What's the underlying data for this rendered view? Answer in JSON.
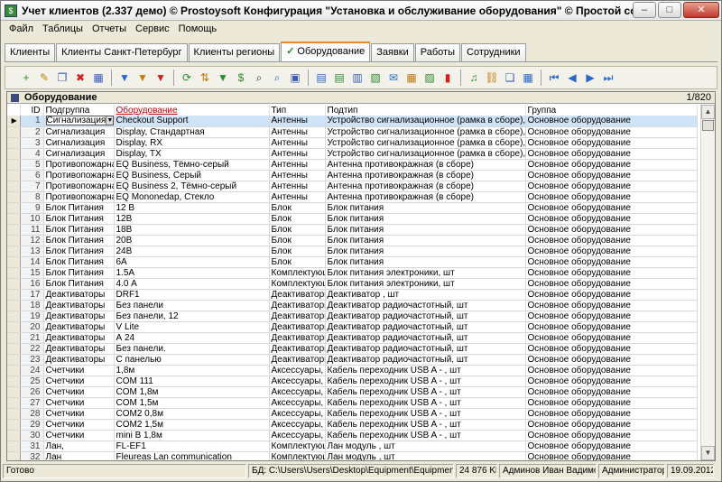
{
  "window": {
    "title": "Учет клиентов (2.337 демо) © Prostoysoft  Конфигурация \"Установка и обслуживание оборудования\" © Простой софт",
    "min": "–",
    "max": "□",
    "close": "✕"
  },
  "menu": [
    {
      "label": "Файл"
    },
    {
      "label": "Таблицы"
    },
    {
      "label": "Отчеты"
    },
    {
      "label": "Сервис"
    },
    {
      "label": "Помощь"
    }
  ],
  "tabs": [
    {
      "label": "Клиенты"
    },
    {
      "label": "Клиенты Санкт-Петербург"
    },
    {
      "label": "Клиенты регионы"
    },
    {
      "label": "Оборудование",
      "active": true
    },
    {
      "label": "Заявки"
    },
    {
      "label": "Работы"
    },
    {
      "label": "Сотрудники"
    }
  ],
  "toolbar": [
    {
      "icon": "add-record-icon",
      "glyph": "+",
      "color": "#2e8b2e"
    },
    {
      "icon": "edit-icon",
      "glyph": "✎",
      "color": "#b8860b"
    },
    {
      "icon": "copy-icon",
      "glyph": "❐",
      "color": "#3b5bb5"
    },
    {
      "icon": "delete-icon",
      "glyph": "✖",
      "color": "#d02020"
    },
    {
      "icon": "card-icon",
      "glyph": "▦",
      "color": "#3b5bb5"
    },
    {
      "sep": true
    },
    {
      "icon": "filter-icon",
      "glyph": "▼",
      "color": "#2a66c8"
    },
    {
      "icon": "filter-edit-icon",
      "glyph": "▼",
      "color": "#c07a10"
    },
    {
      "icon": "filter-clear-icon",
      "glyph": "▼",
      "color": "#d02020"
    },
    {
      "sep": true
    },
    {
      "icon": "refresh-icon",
      "glyph": "⟳",
      "color": "#2e8b2e"
    },
    {
      "icon": "sort-asc-icon",
      "glyph": "⇅",
      "color": "#c07a10"
    },
    {
      "icon": "sort-filter-icon",
      "glyph": "▼",
      "color": "#2e8b2e"
    },
    {
      "icon": "dollar-icon",
      "glyph": "$",
      "color": "#2e8b2e"
    },
    {
      "icon": "find-icon",
      "glyph": "⌕",
      "color": "#333333"
    },
    {
      "icon": "find-next-icon",
      "glyph": "⌕",
      "color": "#2a66c8"
    },
    {
      "icon": "preview-icon",
      "glyph": "▣",
      "color": "#3b5bb5"
    },
    {
      "sep": true
    },
    {
      "icon": "export-icon",
      "glyph": "▤",
      "color": "#2a66c8"
    },
    {
      "icon": "import-icon",
      "glyph": "▤",
      "color": "#2e8b2e"
    },
    {
      "icon": "print-icon",
      "glyph": "▥",
      "color": "#3b5bb5"
    },
    {
      "icon": "report-icon",
      "glyph": "▧",
      "color": "#2e8b2e"
    },
    {
      "icon": "mail-icon",
      "glyph": "✉",
      "color": "#2a66c8"
    },
    {
      "icon": "calendar-icon",
      "glyph": "▦",
      "color": "#c07a10"
    },
    {
      "icon": "photo-icon",
      "glyph": "▨",
      "color": "#2e8b2e"
    },
    {
      "icon": "chart-icon",
      "glyph": "▮",
      "color": "#d02020"
    },
    {
      "sep": true
    },
    {
      "icon": "music-icon",
      "glyph": "♫",
      "color": "#2e8b2e"
    },
    {
      "icon": "link-icon",
      "glyph": "⛓",
      "color": "#c07a10"
    },
    {
      "icon": "attach-icon",
      "glyph": "❏",
      "color": "#3b5bb5"
    },
    {
      "icon": "table-settings-icon",
      "glyph": "▦",
      "color": "#2a66c8"
    },
    {
      "sep": true
    },
    {
      "icon": "first-record-icon",
      "glyph": "⏮",
      "color": "#2a66c8"
    },
    {
      "icon": "prev-record-icon",
      "glyph": "◀",
      "color": "#2a66c8"
    },
    {
      "icon": "next-record-icon",
      "glyph": "▶",
      "color": "#2a66c8"
    },
    {
      "icon": "last-record-icon",
      "glyph": "⏭",
      "color": "#2a66c8"
    }
  ],
  "panel": {
    "title": "Оборудование",
    "counter": "1/820"
  },
  "columns": [
    "ID",
    "Подгруппа",
    "Оборудование",
    "Тип",
    "Подтип",
    "Группа"
  ],
  "rows": [
    [
      "1",
      "Сигнализация",
      "Checkout Support",
      "Антенны",
      "Устройство сигнализационное (рамка в сборе), шт",
      "Основное оборудование"
    ],
    [
      "2",
      "Сигнализация",
      "Display, Стандартная",
      "Антенны",
      "Устройство сигнализационное (рамка в сборе), шт",
      "Основное оборудование"
    ],
    [
      "3",
      "Сигнализация",
      "Display, RX",
      "Антенны",
      "Устройство сигнализационное (рамка в сборе), шт",
      "Основное оборудование"
    ],
    [
      "4",
      "Сигнализация",
      "Display, TX",
      "Антенны",
      "Устройство сигнализационное (рамка в сборе), шт",
      "Основное оборудование"
    ],
    [
      "5",
      "Противопожарная",
      "EQ Business, Тёмно-серый",
      "Антенны",
      "Антенна противокражная (в сборе)",
      "Основное оборудование"
    ],
    [
      "6",
      "Противопожарная",
      "EQ Business, Серый",
      "Антенны",
      "Антенна противокражная (в сборе)",
      "Основное оборудование"
    ],
    [
      "7",
      "Противопожарная",
      "EQ Business 2, Тёмно-серый",
      "Антенны",
      "Антенна противокражная (в сборе)",
      "Основное оборудование"
    ],
    [
      "8",
      "Противопожарная",
      "EQ Mononedap, Стекло",
      "Антенны",
      "Антенна противокражная (в сборе)",
      "Основное оборудование"
    ],
    [
      "9",
      "Блок Питания",
      "12 В",
      "Блок",
      "Блок питания",
      "Основное оборудование"
    ],
    [
      "10",
      "Блок Питания",
      "12В",
      "Блок",
      "Блок питания",
      "Основное оборудование"
    ],
    [
      "11",
      "Блок Питания",
      "18В",
      "Блок",
      "Блок питания",
      "Основное оборудование"
    ],
    [
      "12",
      "Блок Питания",
      "20В",
      "Блок",
      "Блок питания",
      "Основное оборудование"
    ],
    [
      "13",
      "Блок Питания",
      "24В",
      "Блок",
      "Блок питания",
      "Основное оборудование"
    ],
    [
      "14",
      "Блок Питания",
      "6А",
      "Блок",
      "Блок питания",
      "Основное оборудование"
    ],
    [
      "15",
      "Блок Питания",
      "1.5А",
      "Комплектующ",
      "Блок питания электроники, шт",
      "Основное оборудование"
    ],
    [
      "16",
      "Блок Питания",
      "4.0 А",
      "Комплектующ",
      "Блок питания электроники, шт",
      "Основное оборудование"
    ],
    [
      "17",
      "Деактиваторы",
      "DRF1",
      "Деактиваторы",
      "Деактиватор , шт",
      "Основное оборудование"
    ],
    [
      "18",
      "Деактиваторы",
      "Без панели",
      "Деактиваторы",
      "Деактиватор радиочастотный, шт",
      "Основное оборудование"
    ],
    [
      "19",
      "Деактиваторы",
      "Без панели, 12",
      "Деактиваторы",
      "Деактиватор радиочастотный, шт",
      "Основное оборудование"
    ],
    [
      "20",
      "Деактиваторы",
      "V Lite",
      "Деактиваторы",
      "Деактиватор радиочастотный, шт",
      "Основное оборудование"
    ],
    [
      "21",
      "Деактиваторы",
      "А 24",
      "Деактиваторы",
      "Деактиватор радиочастотный, шт",
      "Основное оборудование"
    ],
    [
      "22",
      "Деактиваторы",
      "Без панели.",
      "Деактиваторы",
      "Деактиватор радиочастотный, шт",
      "Основное оборудование"
    ],
    [
      "23",
      "Деактиваторы",
      "С панелью",
      "Деактиваторы",
      "Деактиватор радиочастотный, шт",
      "Основное оборудование"
    ],
    [
      "24",
      "Счетчики",
      "1,8м",
      "Аксессуары,",
      "Кабель переходник USB A -  , шт",
      "Основное оборудование"
    ],
    [
      "25",
      "Счетчики",
      "COM 111",
      "Аксессуары,",
      "Кабель переходник USB A -  , шт",
      "Основное оборудование"
    ],
    [
      "26",
      "Счетчики",
      "COM 1,8м",
      "Аксессуары,",
      "Кабель переходник USB A -  , шт",
      "Основное оборудование"
    ],
    [
      "27",
      "Счетчики",
      "COM 1,5м",
      "Аксессуары,",
      "Кабель переходник USB A -  , шт",
      "Основное оборудование"
    ],
    [
      "28",
      "Счетчики",
      "COM2 0,8м",
      "Аксессуары,",
      "Кабель переходник USB A -  , шт",
      "Основное оборудование"
    ],
    [
      "29",
      "Счетчики",
      "COM2 1,5м",
      "Аксессуары,",
      "Кабель переходник USB A -  , шт",
      "Основное оборудование"
    ],
    [
      "30",
      "Счетчики",
      "mini B 1,8м",
      "Аксессуары,",
      "Кабель переходник USB A -  , шт",
      "Основное оборудование"
    ],
    [
      "31",
      "Лан,",
      "FL-EF1",
      "Комплектующ",
      "Лан модуль , шт",
      "Основное оборудование"
    ],
    [
      "32",
      "Лан",
      "Fleureas Lan communication",
      "Комплектующ",
      "Лан модуль , шт",
      "Основное оборудование"
    ]
  ],
  "status": {
    "ready": "Готово",
    "db_label": "БД:",
    "db_path": "C:\\Users\\Users\\Desktop\\Equipment\\Equipment.mdb",
    "db_size": "24 876 Kb",
    "user": "Админов Иван Вадимович",
    "role": "Администратор",
    "date": "19.09.2012"
  }
}
